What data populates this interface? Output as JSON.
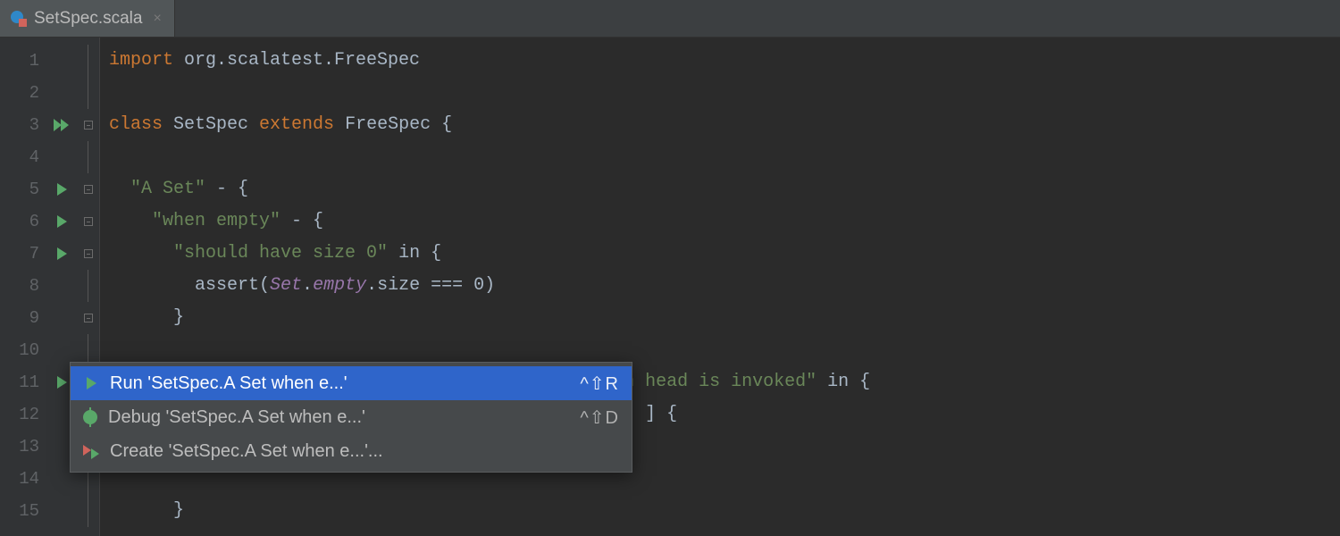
{
  "tab": {
    "filename": "SetSpec.scala",
    "close_glyph": "×"
  },
  "gutter": {
    "run_markers": {
      "3": "double",
      "5": "single",
      "6": "single",
      "7": "single",
      "11": "single"
    },
    "fold_markers": {
      "3": "box",
      "5": "box",
      "6": "box",
      "7": "box",
      "9": "box",
      "11": "box",
      "15": "line",
      "4": "line",
      "8": "line",
      "10": "line",
      "12": "line",
      "13": "line",
      "14": "line"
    }
  },
  "code": {
    "lines": [
      {
        "n": 1,
        "tokens": [
          [
            "kw",
            "import"
          ],
          [
            "pl",
            " org.scalatest.FreeSpec"
          ]
        ]
      },
      {
        "n": 2,
        "tokens": []
      },
      {
        "n": 3,
        "tokens": [
          [
            "kw",
            "class"
          ],
          [
            "pl",
            " SetSpec "
          ],
          [
            "kw",
            "extends"
          ],
          [
            "pl",
            " FreeSpec {"
          ]
        ]
      },
      {
        "n": 4,
        "tokens": []
      },
      {
        "n": 5,
        "tokens": [
          [
            "pl",
            "  "
          ],
          [
            "str",
            "\"A Set\""
          ],
          [
            "pl",
            " - {"
          ]
        ]
      },
      {
        "n": 6,
        "tokens": [
          [
            "pl",
            "    "
          ],
          [
            "str",
            "\"when empty\""
          ],
          [
            "pl",
            " - {"
          ]
        ]
      },
      {
        "n": 7,
        "tokens": [
          [
            "pl",
            "      "
          ],
          [
            "str",
            "\"should have size 0\""
          ],
          [
            "pl",
            " in {"
          ]
        ]
      },
      {
        "n": 8,
        "tokens": [
          [
            "pl",
            "        assert("
          ],
          [
            "it",
            "Set"
          ],
          [
            "pl",
            "."
          ],
          [
            "it",
            "empty"
          ],
          [
            "pl",
            ".size === 0)"
          ]
        ]
      },
      {
        "n": 9,
        "tokens": [
          [
            "pl",
            "      }"
          ]
        ]
      },
      {
        "n": 10,
        "tokens": []
      },
      {
        "n": 11,
        "tokens": [
          [
            "pl",
            "      "
          ],
          [
            "str",
            "\"should produce NoSuchElementException when head is invoked\""
          ],
          [
            "pl",
            " in {"
          ]
        ]
      },
      {
        "n": 12,
        "tokens": [
          [
            "pl",
            "                                                  ] {"
          ]
        ]
      },
      {
        "n": 13,
        "tokens": []
      },
      {
        "n": 14,
        "tokens": []
      },
      {
        "n": 15,
        "tokens": [
          [
            "pl",
            "      }"
          ]
        ]
      }
    ]
  },
  "context_menu": {
    "items": [
      {
        "icon": "run",
        "label": "Run 'SetSpec.A Set when e...'",
        "shortcut": "^⇧R",
        "selected": true
      },
      {
        "icon": "debug",
        "label": "Debug 'SetSpec.A Set when e...'",
        "shortcut": "^⇧D",
        "selected": false
      },
      {
        "icon": "create",
        "label": "Create 'SetSpec.A Set when e...'...",
        "shortcut": "",
        "selected": false
      }
    ]
  }
}
